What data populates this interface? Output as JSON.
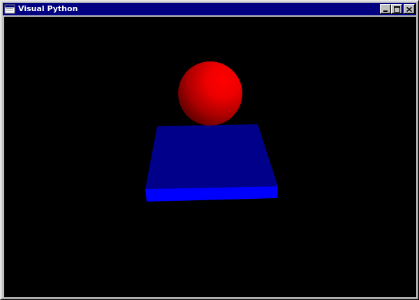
{
  "window": {
    "title": "Visual Python",
    "icon": "window-app-icon",
    "buttons": [
      "minimize-icon",
      "maximize-icon",
      "close-icon"
    ]
  },
  "scene": {
    "background": "#000000",
    "objects": [
      {
        "type": "sphere",
        "color": "#ff0000"
      },
      {
        "type": "box",
        "color": "#0000ff"
      }
    ]
  },
  "colors": {
    "titlebar": "#000080",
    "title_text": "#ffffff",
    "chrome": "#c0c0c0"
  }
}
